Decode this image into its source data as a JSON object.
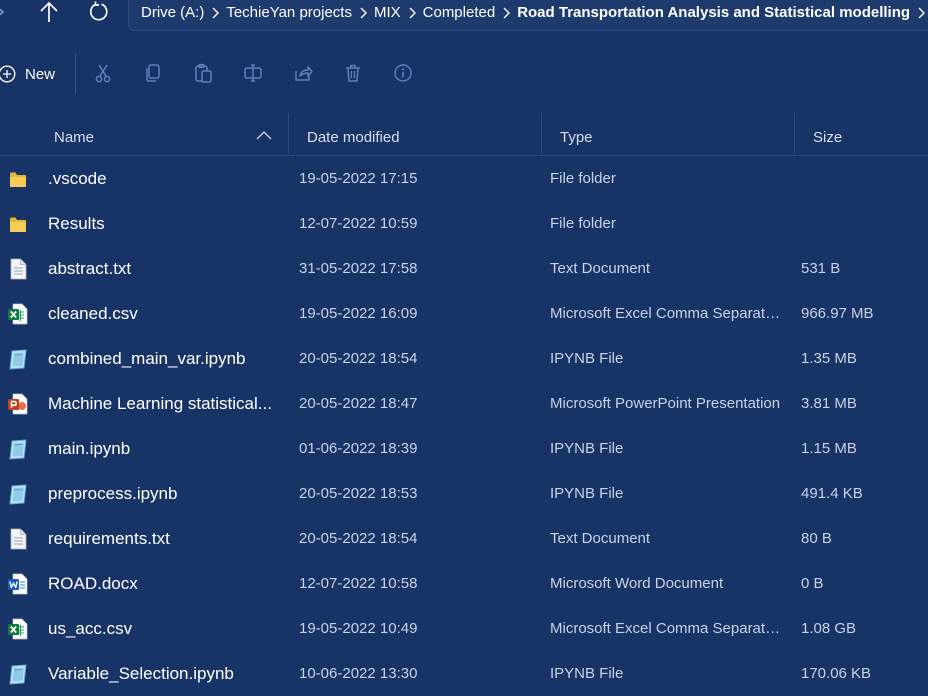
{
  "address": {
    "crumbs": [
      "Drive (A:)",
      "TechieYan projects",
      "MIX",
      "Completed",
      "Road Transportation Analysis and Statistical modelling"
    ]
  },
  "toolbar": {
    "new_label": "New",
    "tools": [
      "cut-icon",
      "copy-icon",
      "paste-icon",
      "rename-icon",
      "share-icon",
      "delete-icon",
      "properties-icon"
    ]
  },
  "columns": {
    "name": "Name",
    "date": "Date modified",
    "type": "Type",
    "size": "Size"
  },
  "files": [
    {
      "icon": "folder-icon",
      "name": ".vscode",
      "date": "19-05-2022 17:15",
      "type": "File folder",
      "size": ""
    },
    {
      "icon": "folder-icon",
      "name": "Results",
      "date": "12-07-2022 10:59",
      "type": "File folder",
      "size": ""
    },
    {
      "icon": "text-file-icon",
      "name": "abstract.txt",
      "date": "31-05-2022 17:58",
      "type": "Text Document",
      "size": "531 B"
    },
    {
      "icon": "excel-icon",
      "name": "cleaned.csv",
      "date": "19-05-2022 16:09",
      "type": "Microsoft Excel Comma Separate...",
      "size": "966.97 MB"
    },
    {
      "icon": "ipynb-icon",
      "name": "combined_main_var.ipynb",
      "date": "20-05-2022 18:54",
      "type": "IPYNB File",
      "size": "1.35 MB"
    },
    {
      "icon": "powerpoint-icon",
      "name": "Machine Learning statistical...",
      "date": "20-05-2022 18:47",
      "type": "Microsoft PowerPoint Presentation",
      "size": "3.81 MB"
    },
    {
      "icon": "ipynb-icon",
      "name": "main.ipynb",
      "date": "01-06-2022 18:39",
      "type": "IPYNB File",
      "size": "1.15 MB"
    },
    {
      "icon": "ipynb-icon",
      "name": "preprocess.ipynb",
      "date": "20-05-2022 18:53",
      "type": "IPYNB File",
      "size": "491.4 KB"
    },
    {
      "icon": "text-file-icon",
      "name": "requirements.txt",
      "date": "20-05-2022 18:54",
      "type": "Text Document",
      "size": "80 B"
    },
    {
      "icon": "word-icon",
      "name": "ROAD.docx",
      "date": "12-07-2022 10:58",
      "type": "Microsoft Word Document",
      "size": "0 B"
    },
    {
      "icon": "excel-icon",
      "name": "us_acc.csv",
      "date": "19-05-2022 10:49",
      "type": "Microsoft Excel Comma Separate...",
      "size": "1.08 GB"
    },
    {
      "icon": "ipynb-icon",
      "name": "Variable_Selection.ipynb",
      "date": "10-06-2022 13:30",
      "type": "IPYNB File",
      "size": "170.06 KB"
    }
  ]
}
